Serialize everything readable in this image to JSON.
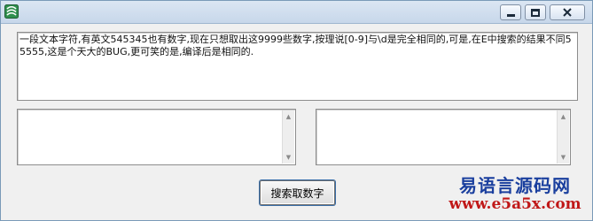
{
  "window": {
    "title": "",
    "icon": "app-icon"
  },
  "caption_buttons": {
    "minimize_icon": "minimize-icon",
    "maximize_icon": "maximize-icon",
    "close_icon": "close-icon"
  },
  "main_text": {
    "value": "一段文本字符,有英文545345也有数字,现在只想取出这9999些数字,按理说[0-9]与\\d是完全相同的,可是,在E中搜索的结果不同55555,这是个天大的BUG,更可笑的是,编译后是相同的."
  },
  "results": {
    "left_value": "",
    "right_value": ""
  },
  "actions": {
    "search_button_label": "搜索取数字"
  },
  "watermark": {
    "line1": "易语言源码网",
    "line2": "www.e5a5x.com"
  },
  "colors": {
    "watermark_blue": "#1a3f9e",
    "watermark_red": "#c01818"
  }
}
